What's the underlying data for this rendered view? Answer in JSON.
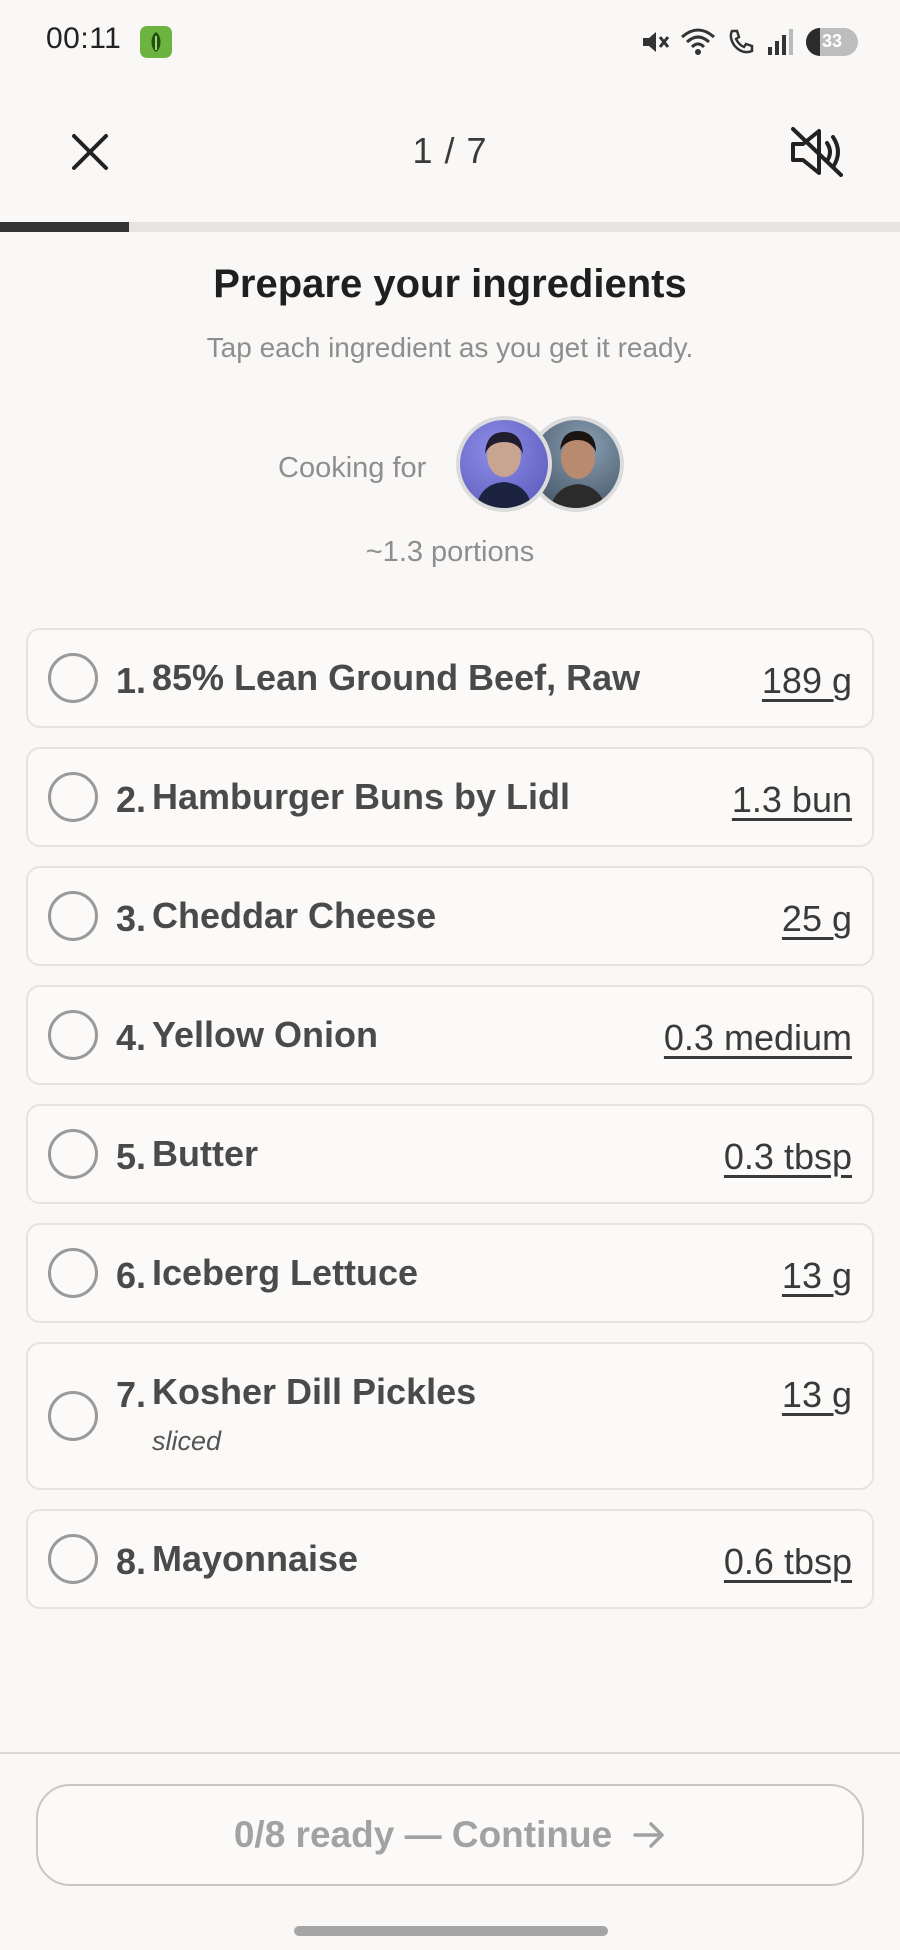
{
  "status_bar": {
    "time": "00:11",
    "battery": "33",
    "icons": [
      "app-notification-icon",
      "mute-icon",
      "wifi-icon",
      "call-icon",
      "signal-icon",
      "battery-icon"
    ]
  },
  "header": {
    "step_counter": "1 / 7",
    "progress_fraction": 0.143
  },
  "intro": {
    "title": "Prepare your ingredients",
    "subtitle": "Tap each ingredient as you get it ready.",
    "cooking_for_label": "Cooking for",
    "portions": "~1.3 portions"
  },
  "ingredients": [
    {
      "index": "1.",
      "name": "85% Lean Ground Beef, Raw",
      "qty": "189 g",
      "note": ""
    },
    {
      "index": "2.",
      "name": "Hamburger Buns by Lidl",
      "qty": "1.3 bun",
      "note": ""
    },
    {
      "index": "3.",
      "name": "Cheddar Cheese",
      "qty": "25 g",
      "note": ""
    },
    {
      "index": "4.",
      "name": "Yellow Onion",
      "qty": "0.3 medium",
      "note": ""
    },
    {
      "index": "5.",
      "name": "Butter",
      "qty": "0.3 tbsp",
      "note": ""
    },
    {
      "index": "6.",
      "name": "Iceberg Lettuce",
      "qty": "13 g",
      "note": ""
    },
    {
      "index": "7.",
      "name": "Kosher Dill Pickles",
      "qty": "13 g",
      "note": "sliced"
    },
    {
      "index": "8.",
      "name": "Mayonnaise",
      "qty": "0.6 tbsp",
      "note": ""
    }
  ],
  "footer": {
    "continue_label": "0/8 ready — Continue"
  },
  "colors": {
    "background": "#f9f8f6",
    "progress": "#333333",
    "muted_text": "#8e8e8e"
  }
}
